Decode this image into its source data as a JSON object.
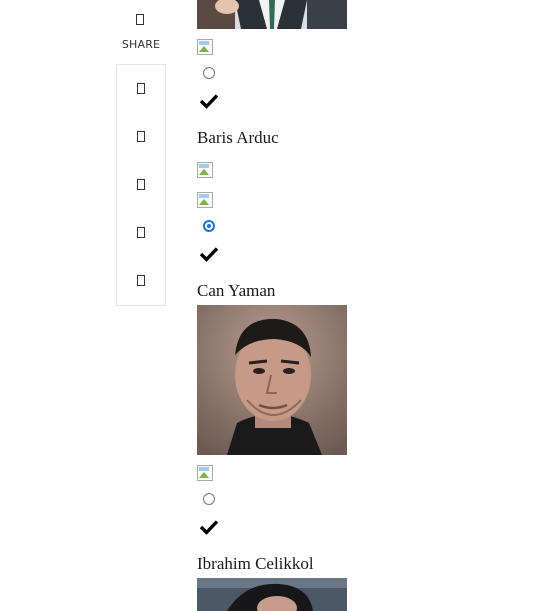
{
  "share": {
    "label": "SHARE",
    "buttons": [
      "facebook-icon",
      "twitter-icon",
      "pinterest-icon",
      "whatsapp-icon",
      "email-icon"
    ]
  },
  "candidates": [
    {
      "name": "Baris Arduc",
      "selected": false
    },
    {
      "name": "Can Yaman",
      "selected": true
    },
    {
      "name": "Ibrahim Celikkol",
      "selected": false
    }
  ]
}
